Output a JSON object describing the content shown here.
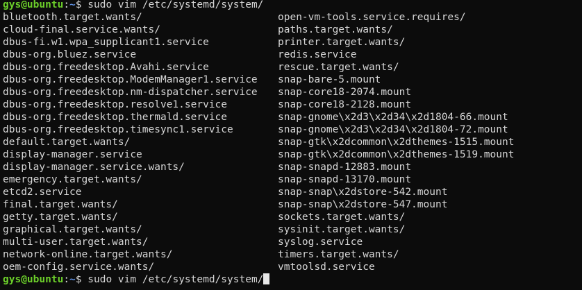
{
  "prompt": {
    "user_host": "gys@ubuntu",
    "colon": ":",
    "path": "~",
    "dollar": "$ "
  },
  "first_command": "sudo vim /etc/systemd/system/",
  "current_input": "sudo vim /etc/systemd/system/",
  "listing": {
    "left": [
      "bluetooth.target.wants/",
      "cloud-final.service.wants/",
      "dbus-fi.w1.wpa_supplicant1.service",
      "dbus-org.bluez.service",
      "dbus-org.freedesktop.Avahi.service",
      "dbus-org.freedesktop.ModemManager1.service",
      "dbus-org.freedesktop.nm-dispatcher.service",
      "dbus-org.freedesktop.resolve1.service",
      "dbus-org.freedesktop.thermald.service",
      "dbus-org.freedesktop.timesync1.service",
      "default.target.wants/",
      "display-manager.service",
      "display-manager.service.wants/",
      "emergency.target.wants/",
      "etcd2.service",
      "final.target.wants/",
      "getty.target.wants/",
      "graphical.target.wants/",
      "multi-user.target.wants/",
      "network-online.target.wants/",
      "oem-config.service.wants/"
    ],
    "right": [
      "open-vm-tools.service.requires/",
      "paths.target.wants/",
      "printer.target.wants/",
      "redis.service",
      "rescue.target.wants/",
      "snap-bare-5.mount",
      "snap-core18-2074.mount",
      "snap-core18-2128.mount",
      "snap-gnome\\x2d3\\x2d34\\x2d1804-66.mount",
      "snap-gnome\\x2d3\\x2d34\\x2d1804-72.mount",
      "snap-gtk\\x2dcommon\\x2dthemes-1515.mount",
      "snap-gtk\\x2dcommon\\x2dthemes-1519.mount",
      "snap-snapd-12883.mount",
      "snap-snapd-13170.mount",
      "snap-snap\\x2dstore-542.mount",
      "snap-snap\\x2dstore-547.mount",
      "sockets.target.wants/",
      "sysinit.target.wants/",
      "syslog.service",
      "timers.target.wants/",
      "vmtoolsd.service"
    ]
  },
  "colors": {
    "background": "#0c0c0c",
    "text": "#d6d6d6",
    "prompt_user": "#6ccf2a",
    "prompt_path": "#5f8fe0"
  }
}
